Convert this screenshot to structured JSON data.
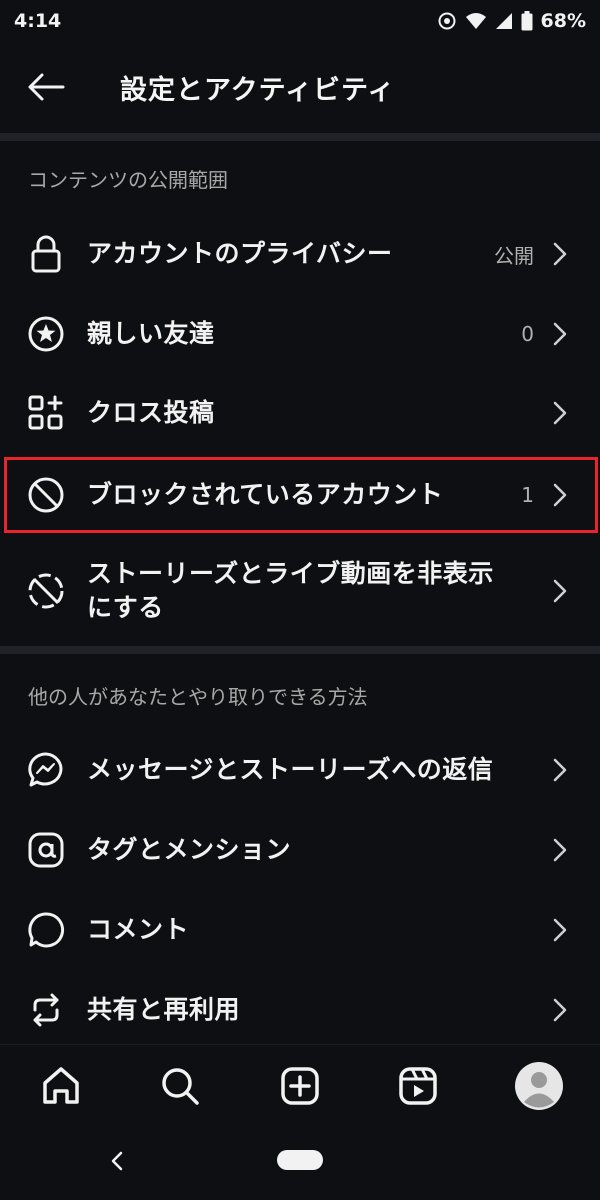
{
  "status_bar": {
    "time": "4:14",
    "battery": "68%",
    "icons": [
      "settings-status-icon",
      "wifi-icon",
      "signal-icon",
      "battery-icon"
    ]
  },
  "header": {
    "title": "設定とアクティビティ",
    "back_icon": "arrow-left-icon"
  },
  "sections": [
    {
      "header": "コンテンツの公開範囲",
      "items": [
        {
          "label": "アカウントのプライバシー",
          "value": "公開",
          "icon": "lock-icon"
        },
        {
          "label": "親しい友達",
          "value": "0",
          "icon": "star-circle-icon"
        },
        {
          "label": "クロス投稿",
          "value": "",
          "icon": "grid-plus-icon"
        },
        {
          "label": "ブロックされているアカウント",
          "value": "1",
          "icon": "block-icon",
          "highlighted": true
        },
        {
          "label_line1": "ストーリーズとライブ動画を非表示",
          "label_line2": "にする",
          "value": "",
          "icon": "hide-story-icon"
        }
      ]
    },
    {
      "header": "他の人があなたとやり取りできる方法",
      "items": [
        {
          "label": "メッセージとストーリーズへの返信",
          "icon": "messenger-icon"
        },
        {
          "label": "タグとメンション",
          "icon": "at-icon"
        },
        {
          "label": "コメント",
          "icon": "comment-icon"
        },
        {
          "label": "共有と再利用",
          "icon": "repost-icon"
        }
      ]
    }
  ],
  "bottom_nav": [
    "home-icon",
    "search-icon",
    "create-icon",
    "reels-icon",
    "profile-avatar"
  ],
  "colors": {
    "background": "#0d0f12",
    "divider": "#1f2226",
    "highlight": "#e8252a",
    "text": "#f2f2f2",
    "muted": "#a8a8a8"
  }
}
